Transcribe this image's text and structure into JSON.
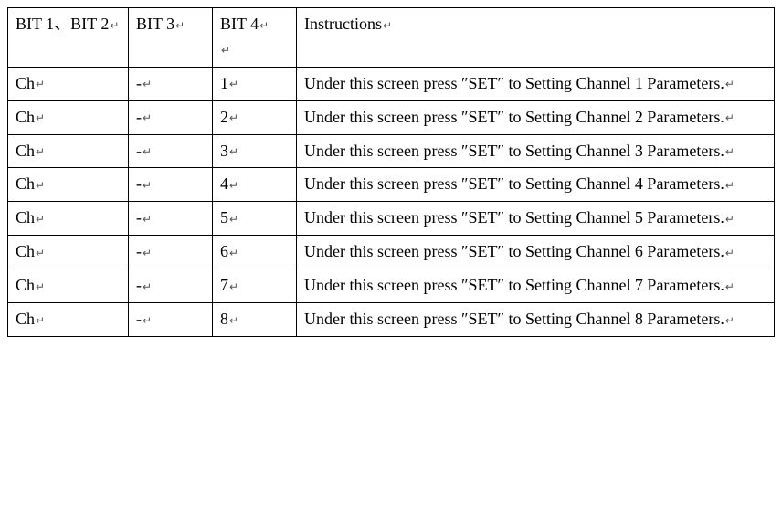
{
  "paragraph_mark": "↵",
  "header": {
    "col1": "BIT 1、BIT 2",
    "col2": "BIT 3",
    "col3_line1": "BIT 4",
    "col3_line2": "",
    "col4": "Instructions"
  },
  "rows": [
    {
      "c1": "Ch",
      "c2": "-",
      "c3": "1",
      "c4": "Under this screen press ″SET″ to Setting Channel 1 Parameters."
    },
    {
      "c1": "Ch",
      "c2": "-",
      "c3": "2",
      "c4": "Under this screen press ″SET″ to Setting Channel 2 Parameters."
    },
    {
      "c1": "Ch",
      "c2": "-",
      "c3": "3",
      "c4": "Under this screen press ″SET″ to Setting Channel 3 Parameters."
    },
    {
      "c1": "Ch",
      "c2": "-",
      "c3": "4",
      "c4": "Under this screen press ″SET″ to Setting Channel 4 Parameters."
    },
    {
      "c1": "Ch",
      "c2": "-",
      "c3": "5",
      "c4": "Under this screen press ″SET″ to Setting Channel 5 Parameters."
    },
    {
      "c1": "Ch",
      "c2": "-",
      "c3": "6",
      "c4": "Under this screen press ″SET″ to Setting Channel 6 Parameters."
    },
    {
      "c1": "Ch",
      "c2": "-",
      "c3": "7",
      "c4": "Under this screen press ″SET″ to Setting Channel 7 Parameters."
    },
    {
      "c1": "Ch",
      "c2": "-",
      "c3": "8",
      "c4": "Under this screen press ″SET″ to Setting Channel 8 Parameters."
    }
  ]
}
